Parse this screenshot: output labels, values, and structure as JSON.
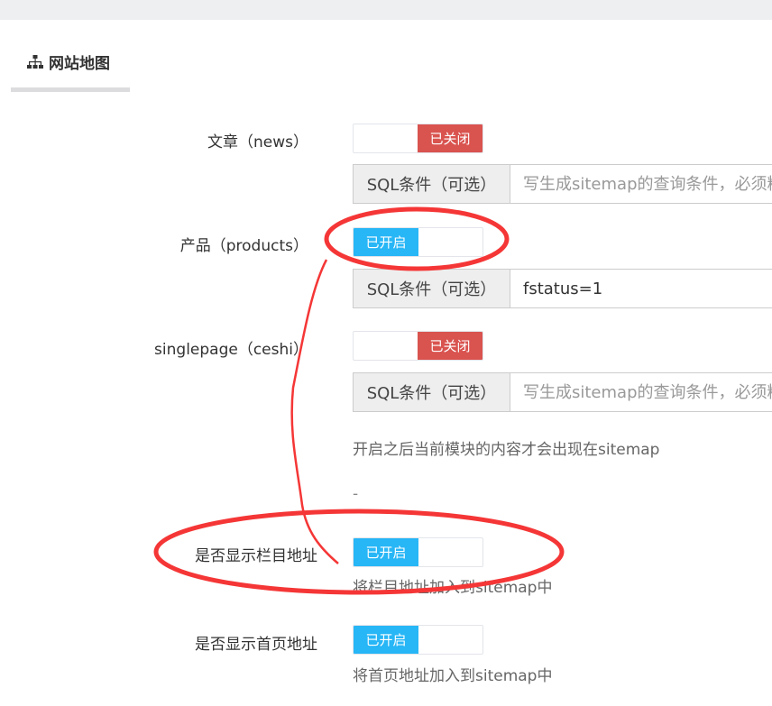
{
  "tab": {
    "icon": "sitemap-icon",
    "label": "网站地图"
  },
  "modules": [
    {
      "label": "文章（news）",
      "state": "已关闭",
      "enabled": false,
      "sql_label": "SQL条件（可选）",
      "sql_value": "",
      "sql_placeholder": "写生成sitemap的查询条件，必须精"
    },
    {
      "label": "产品（products）",
      "state": "已开启",
      "enabled": true,
      "sql_label": "SQL条件（可选）",
      "sql_value": "fstatus=1",
      "sql_placeholder": ""
    },
    {
      "label": "singlepage（ceshi）",
      "state": "已关闭",
      "enabled": false,
      "sql_label": "SQL条件（可选）",
      "sql_value": "",
      "sql_placeholder": "写生成sitemap的查询条件，必须精"
    }
  ],
  "modules_help": "开启之后当前模块的内容才会出现在sitemap",
  "dash": "-",
  "show_category": {
    "label": "是否显示栏目地址",
    "state": "已开启",
    "enabled": true,
    "help": "将栏目地址加入到sitemap中"
  },
  "show_home": {
    "label": "是否显示首页地址",
    "state": "已开启",
    "enabled": true,
    "help": "将首页地址加入到sitemap中"
  },
  "colors": {
    "on": "#27b6f6",
    "off": "#d9534f",
    "annotation": "#f53636"
  }
}
